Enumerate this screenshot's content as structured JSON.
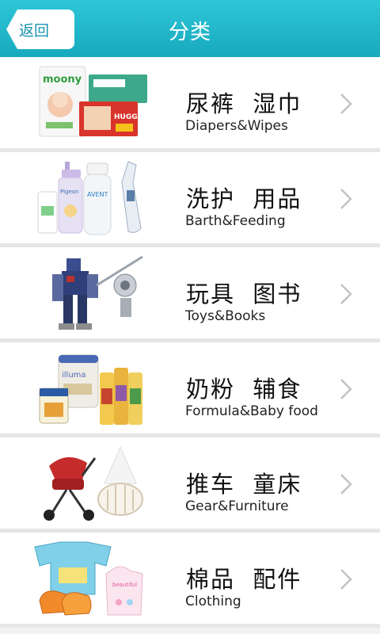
{
  "header": {
    "back_label": "返回",
    "title": "分类"
  },
  "categories": [
    {
      "zh": "尿裤  湿巾",
      "en": "Diapers&Wipes",
      "icon": "diapers-image"
    },
    {
      "zh": "洗护  用品",
      "en": "Barth&Feeding",
      "icon": "bath-feeding-image"
    },
    {
      "zh": "玩具  图书",
      "en": "Toys&Books",
      "icon": "toy-robot-image"
    },
    {
      "zh": "奶粉  辅食",
      "en": "Formula&Baby food",
      "icon": "formula-image"
    },
    {
      "zh": "推车  童床",
      "en": "Gear&Furniture",
      "icon": "stroller-crib-image"
    },
    {
      "zh": "棉品  配件",
      "en": "Clothing",
      "icon": "clothing-image"
    }
  ],
  "colors": {
    "header": "#1fb4c8",
    "back_text": "#1a93b1",
    "chevron": "#c2c2c2"
  }
}
